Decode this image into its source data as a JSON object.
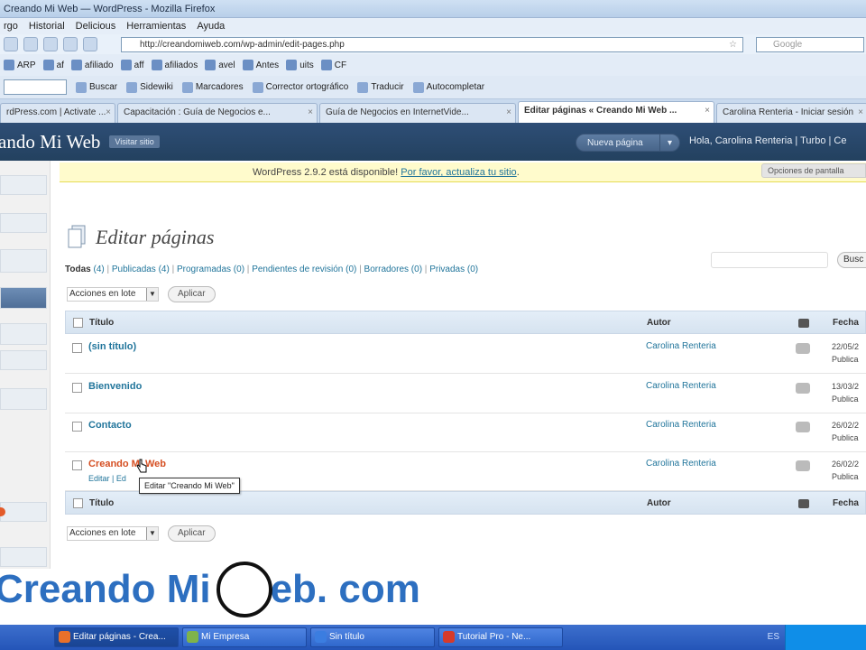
{
  "browser": {
    "title": "Creando Mi Web — WordPress - Mozilla Firefox",
    "menu": [
      "rgo",
      "Historial",
      "Delicious",
      "Herramientas",
      "Ayuda"
    ],
    "url": "http://creandomiweb.com/wp-admin/edit-pages.php",
    "search_placeholder": "Google",
    "bookmarks": [
      "ARP",
      "af",
      "afiliado",
      "aff",
      "afiliados",
      "avel",
      "Antes",
      "uits",
      "CF"
    ],
    "toolbar2": [
      "Buscar",
      "Sidewiki",
      "Marcadores",
      "Corrector ortográfico",
      "Traducir",
      "Autocompletar"
    ],
    "tabs": [
      {
        "label": "rdPress.com | Activate ...",
        "active": false
      },
      {
        "label": "Capacitación : Guía de Negocios e...",
        "active": false
      },
      {
        "label": "Guía de Negocios en InternetVide...",
        "active": false
      },
      {
        "label": "Editar páginas « Creando Mi Web ...",
        "active": true
      },
      {
        "label": "Carolina Renteria - Iniciar sesión",
        "active": false
      }
    ]
  },
  "wp": {
    "site_title": "ando Mi Web",
    "visit_site": "Visitar sitio",
    "new_page": "Nueva página",
    "howdy": "Hola, Carolina Renteria | Turbo | Ce",
    "notice_text": "WordPress 2.9.2 está disponible! ",
    "notice_link": "Por favor, actualiza tu sitio",
    "notice_end": ".",
    "screen_options": "Opciones de pantalla",
    "heading": "Editar páginas",
    "filters": [
      {
        "label": "Todas",
        "count": "(4)",
        "current": true
      },
      {
        "label": "Publicadas",
        "count": "(4)",
        "current": false
      },
      {
        "label": "Programadas",
        "count": "(0)",
        "current": false
      },
      {
        "label": "Pendientes de revisión",
        "count": "(0)",
        "current": false
      },
      {
        "label": "Borradores",
        "count": "(0)",
        "current": false
      },
      {
        "label": "Privadas",
        "count": "(0)",
        "current": false
      }
    ],
    "search_button": "Busc",
    "bulk_label": "Acciones en lote",
    "apply_label": "Aplicar",
    "columns": {
      "title": "Título",
      "author": "Autor",
      "date": "Fecha"
    },
    "rows": [
      {
        "title": "(sin título)",
        "author": "Carolina Renteria",
        "date": "22/05/2",
        "status": "Publica"
      },
      {
        "title": "Bienvenido",
        "author": "Carolina Renteria",
        "date": "13/03/2",
        "status": "Publica"
      },
      {
        "title": "Contacto",
        "author": "Carolina Renteria",
        "date": "26/02/2",
        "status": "Publica"
      },
      {
        "title": "Creando Mi Web",
        "author": "Carolina Renteria",
        "date": "26/02/2",
        "status": "Publica",
        "actions": "Editar | Ed"
      }
    ],
    "tooltip": "Editar \"Creando Mi Web\""
  },
  "watermark": {
    "before": "Creando Mi",
    "after": "eb. com"
  },
  "taskbar": {
    "tasks": [
      {
        "label": "Editar páginas - Crea...",
        "active": true,
        "color": "#e8702a"
      },
      {
        "label": "Mi Empresa",
        "active": false,
        "color": "#7fb34a"
      },
      {
        "label": "Sin título",
        "active": false,
        "color": "#3b7de0"
      },
      {
        "label": "Tutorial Pro - Ne...",
        "active": false,
        "color": "#d63a2a"
      }
    ],
    "tray_label": "ES"
  }
}
